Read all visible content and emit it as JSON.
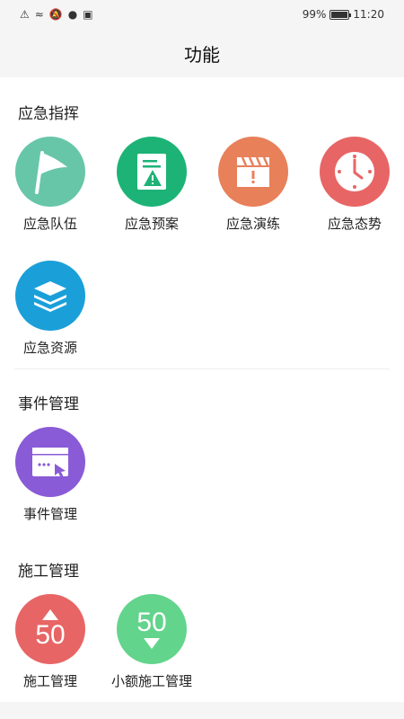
{
  "status_bar": {
    "battery_percent": "99%",
    "time": "11:20"
  },
  "header": {
    "title": "功能"
  },
  "sections": [
    {
      "title": "应急指挥",
      "items": [
        {
          "label": "应急队伍",
          "icon": "flag-icon",
          "color": "#67c6a8"
        },
        {
          "label": "应急预案",
          "icon": "document-warning-icon",
          "color": "#1db377"
        },
        {
          "label": "应急演练",
          "icon": "clapperboard-icon",
          "color": "#e8805a"
        },
        {
          "label": "应急态势",
          "icon": "clock-icon",
          "color": "#e86565"
        },
        {
          "label": "应急资源",
          "icon": "layers-icon",
          "color": "#1a9fd9"
        }
      ]
    },
    {
      "title": "事件管理",
      "items": [
        {
          "label": "事件管理",
          "icon": "window-cursor-icon",
          "color": "#8a5bd6"
        }
      ]
    },
    {
      "title": "施工管理",
      "items": [
        {
          "label": "施工管理",
          "icon": "triangle-up-50-icon",
          "icon_text": "50",
          "color": "#e86565"
        },
        {
          "label": "小额施工管理",
          "icon": "triangle-down-50-icon",
          "icon_text": "50",
          "color": "#63d48c"
        }
      ]
    }
  ]
}
